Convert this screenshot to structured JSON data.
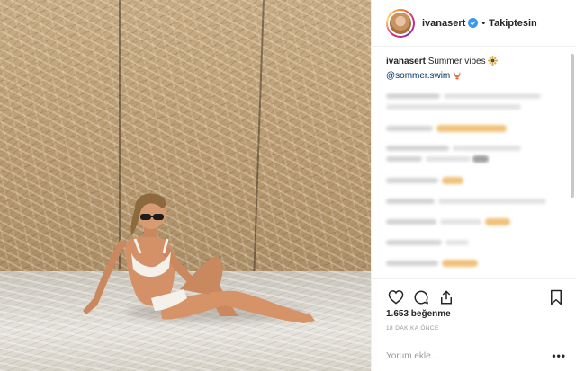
{
  "post": {
    "username": "ivanasert",
    "follow_state": "Takiptesin",
    "separator": "•",
    "verified_icon": "verified-badge-icon",
    "accent_color": "#3897f0",
    "caption": {
      "user": "ivanasert",
      "text": "Summer vibes",
      "emoji_1": "sun-flower-emoji",
      "mention": "@sommer.swim",
      "emoji_2": "bikini-emoji"
    },
    "likes": "1.653 beğenme",
    "timestamp": "18 DAKİKA ÖNCE",
    "comment_placeholder": "Yorum ekle...",
    "more_label": "•••",
    "comments_blurred": true
  },
  "actions": {
    "like_icon": "heart-icon",
    "comment_icon": "comment-icon",
    "share_icon": "share-icon",
    "save_icon": "bookmark-icon"
  },
  "photo": {
    "description_icon": "post-photo"
  }
}
